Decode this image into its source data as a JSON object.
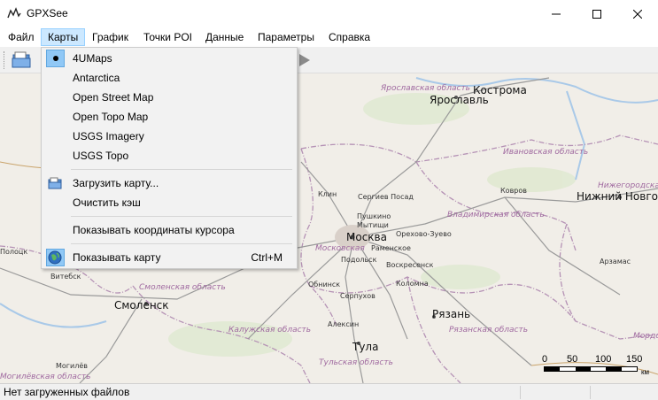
{
  "window": {
    "title": "GPXSee"
  },
  "menubar": {
    "items": [
      {
        "label": "Файл"
      },
      {
        "label": "Карты"
      },
      {
        "label": "График"
      },
      {
        "label": "Точки POI"
      },
      {
        "label": "Данные"
      },
      {
        "label": "Параметры"
      },
      {
        "label": "Справка"
      }
    ]
  },
  "maps_menu": {
    "maps": [
      {
        "label": "4UMaps",
        "checked": true
      },
      {
        "label": "Antarctica"
      },
      {
        "label": "Open Street Map"
      },
      {
        "label": "Open Topo Map"
      },
      {
        "label": "USGS Imagery"
      },
      {
        "label": "USGS Topo"
      }
    ],
    "load_map": "Загрузить карту...",
    "clear_cache": "Очистить кэш",
    "show_cursor_coords": "Показывать координаты курсора",
    "show_map": "Показывать карту",
    "show_map_shortcut": "Ctrl+M"
  },
  "map": {
    "cities": [
      {
        "name": "Кострома"
      },
      {
        "name": "Ярославль"
      },
      {
        "name": "Москва"
      },
      {
        "name": "Нижний Новгород"
      },
      {
        "name": "Смоленск"
      },
      {
        "name": "Рязань"
      },
      {
        "name": "Тула"
      }
    ],
    "towns": [
      {
        "name": "Клин"
      },
      {
        "name": "Сергиев Посад"
      },
      {
        "name": "Ковров"
      },
      {
        "name": "Пушкино"
      },
      {
        "name": "Мытищи"
      },
      {
        "name": "Орехово-Зуево"
      },
      {
        "name": "Раменское"
      },
      {
        "name": "Подольск"
      },
      {
        "name": "Воскресенск"
      },
      {
        "name": "Обнинск"
      },
      {
        "name": "Серпухов"
      },
      {
        "name": "Коломна"
      },
      {
        "name": "Алексин"
      },
      {
        "name": "Арзамас"
      },
      {
        "name": "Витебск"
      },
      {
        "name": "Полоцк"
      },
      {
        "name": "Могилёв"
      }
    ],
    "regions": [
      {
        "name": "Ярославская область"
      },
      {
        "name": "Ивановская область"
      },
      {
        "name": "Владимирская область"
      },
      {
        "name": "Нижегородская область"
      },
      {
        "name": "Московская"
      },
      {
        "name": "Смоленская область"
      },
      {
        "name": "Калужская область"
      },
      {
        "name": "Рязанская область"
      },
      {
        "name": "Тульская область"
      },
      {
        "name": "Мордо"
      },
      {
        "name": "Могилёвская область"
      }
    ],
    "scale": {
      "ticks": [
        "0",
        "50",
        "100",
        "150"
      ],
      "unit": "км"
    }
  },
  "status": {
    "text": "Нет загруженных файлов"
  },
  "colors": {
    "menu_highlight": "#cce8ff",
    "map_bg": "#f1eee8",
    "border": "#b592b5",
    "road": "#9a9a9a"
  }
}
